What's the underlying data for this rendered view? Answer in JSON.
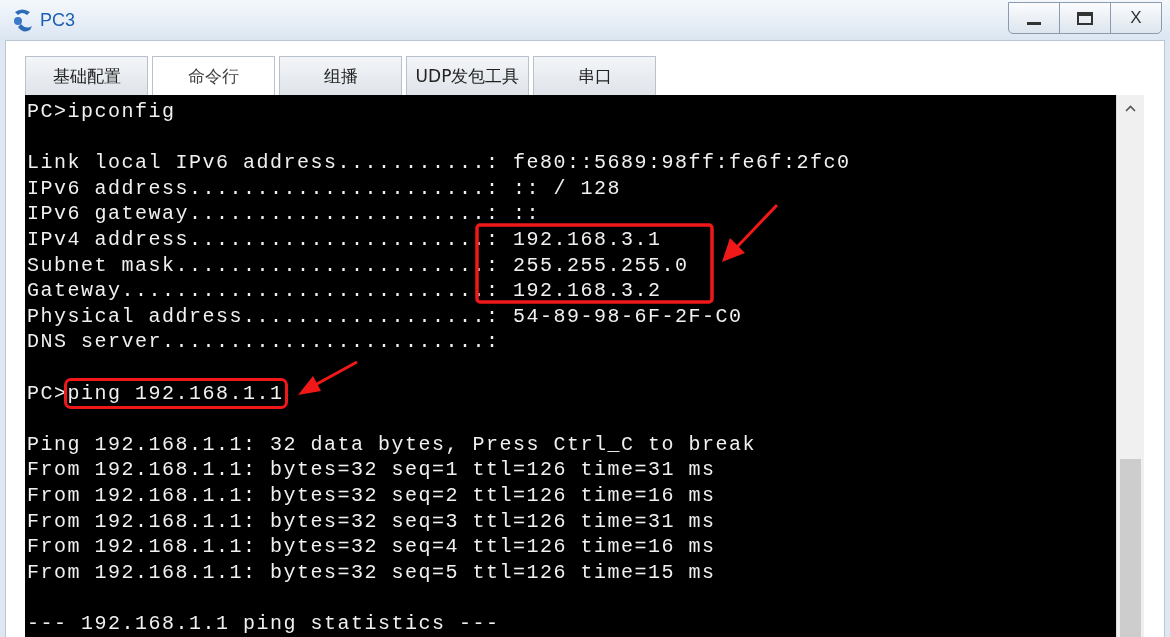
{
  "window": {
    "title": "PC3",
    "controls": [
      {
        "kind": "minimize"
      },
      {
        "kind": "maximize"
      },
      {
        "kind": "close",
        "label": "X"
      }
    ]
  },
  "tabs": [
    {
      "label": "基础配置",
      "selected": false
    },
    {
      "label": "命令行",
      "selected": true
    },
    {
      "label": "组播",
      "selected": false
    },
    {
      "label": "UDP发包工具",
      "selected": false
    },
    {
      "label": "串口",
      "selected": false
    }
  ],
  "terminal": {
    "blocks": [
      [
        "PC>ipconfig"
      ],
      [
        "Link local IPv6 address...........: fe80::5689:98ff:fe6f:2fc0",
        "IPv6 address......................: :: / 128",
        "IPv6 gateway......................: ::",
        "IPv4 address......................: 192.168.3.1",
        "Subnet mask.......................: 255.255.255.0",
        "Gateway...........................: 192.168.3.2",
        "Physical address..................: 54-89-98-6F-2F-C0",
        "DNS server........................:"
      ],
      [
        {
          "prompt": "PC>",
          "command": "ping 192.168.1.1",
          "highlighted": true
        }
      ],
      [
        "Ping 192.168.1.1: 32 data bytes, Press Ctrl_C to break",
        "From 192.168.1.1: bytes=32 seq=1 ttl=126 time=31 ms",
        "From 192.168.1.1: bytes=32 seq=2 ttl=126 time=16 ms",
        "From 192.168.1.1: bytes=32 seq=3 ttl=126 time=31 ms",
        "From 192.168.1.1: bytes=32 seq=4 ttl=126 time=16 ms",
        "From 192.168.1.1: bytes=32 seq=5 ttl=126 time=15 ms"
      ],
      [
        "--- 192.168.1.1 ping statistics ---"
      ]
    ]
  }
}
